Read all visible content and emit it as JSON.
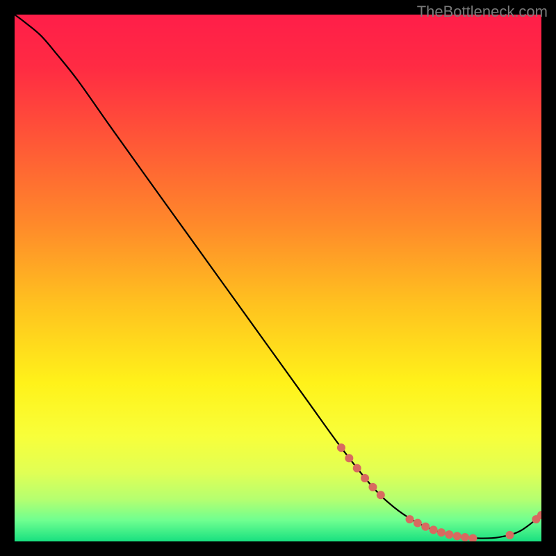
{
  "watermark": "TheBottleneck.com",
  "chart_data": {
    "type": "line",
    "title": "",
    "xlabel": "",
    "ylabel": "",
    "xlim": [
      0,
      100
    ],
    "ylim": [
      0,
      100
    ],
    "gradient_stops": [
      {
        "offset": 0.0,
        "color": "#ff1e49"
      },
      {
        "offset": 0.1,
        "color": "#ff2b43"
      },
      {
        "offset": 0.25,
        "color": "#ff5a36"
      },
      {
        "offset": 0.4,
        "color": "#ff8a2a"
      },
      {
        "offset": 0.55,
        "color": "#ffc21f"
      },
      {
        "offset": 0.7,
        "color": "#fff21a"
      },
      {
        "offset": 0.8,
        "color": "#f8ff3a"
      },
      {
        "offset": 0.87,
        "color": "#e0ff55"
      },
      {
        "offset": 0.92,
        "color": "#b5ff70"
      },
      {
        "offset": 0.96,
        "color": "#6fff90"
      },
      {
        "offset": 1.0,
        "color": "#18e080"
      }
    ],
    "series": [
      {
        "name": "bottleneck-curve",
        "color": "#000000",
        "x": [
          0.0,
          2.0,
          5.0,
          8.0,
          12.0,
          18.0,
          25.0,
          35.0,
          45.0,
          55.0,
          62.0,
          68.0,
          72.0,
          76.0,
          80.0,
          84.0,
          88.0,
          92.0,
          96.0,
          100.0
        ],
        "y": [
          100.0,
          98.5,
          96.0,
          92.5,
          87.5,
          79.0,
          69.2,
          55.3,
          41.4,
          27.5,
          17.8,
          10.3,
          6.5,
          3.8,
          2.0,
          1.0,
          0.6,
          0.8,
          2.0,
          5.0
        ]
      }
    ],
    "markers": [
      {
        "name": "highlight-dots",
        "color": "#d86a60",
        "radius": 6,
        "points": [
          {
            "x": 62.0,
            "y": 17.8
          },
          {
            "x": 63.5,
            "y": 15.8
          },
          {
            "x": 65.0,
            "y": 13.9
          },
          {
            "x": 66.5,
            "y": 12.0
          },
          {
            "x": 68.0,
            "y": 10.3
          },
          {
            "x": 69.5,
            "y": 8.8
          },
          {
            "x": 75.0,
            "y": 4.2
          },
          {
            "x": 76.5,
            "y": 3.5
          },
          {
            "x": 78.0,
            "y": 2.8
          },
          {
            "x": 79.5,
            "y": 2.2
          },
          {
            "x": 81.0,
            "y": 1.7
          },
          {
            "x": 82.5,
            "y": 1.3
          },
          {
            "x": 84.0,
            "y": 1.0
          },
          {
            "x": 85.5,
            "y": 0.8
          },
          {
            "x": 87.0,
            "y": 0.6
          },
          {
            "x": 94.0,
            "y": 1.2
          },
          {
            "x": 99.0,
            "y": 4.2
          },
          {
            "x": 100.0,
            "y": 5.0
          }
        ]
      }
    ]
  }
}
